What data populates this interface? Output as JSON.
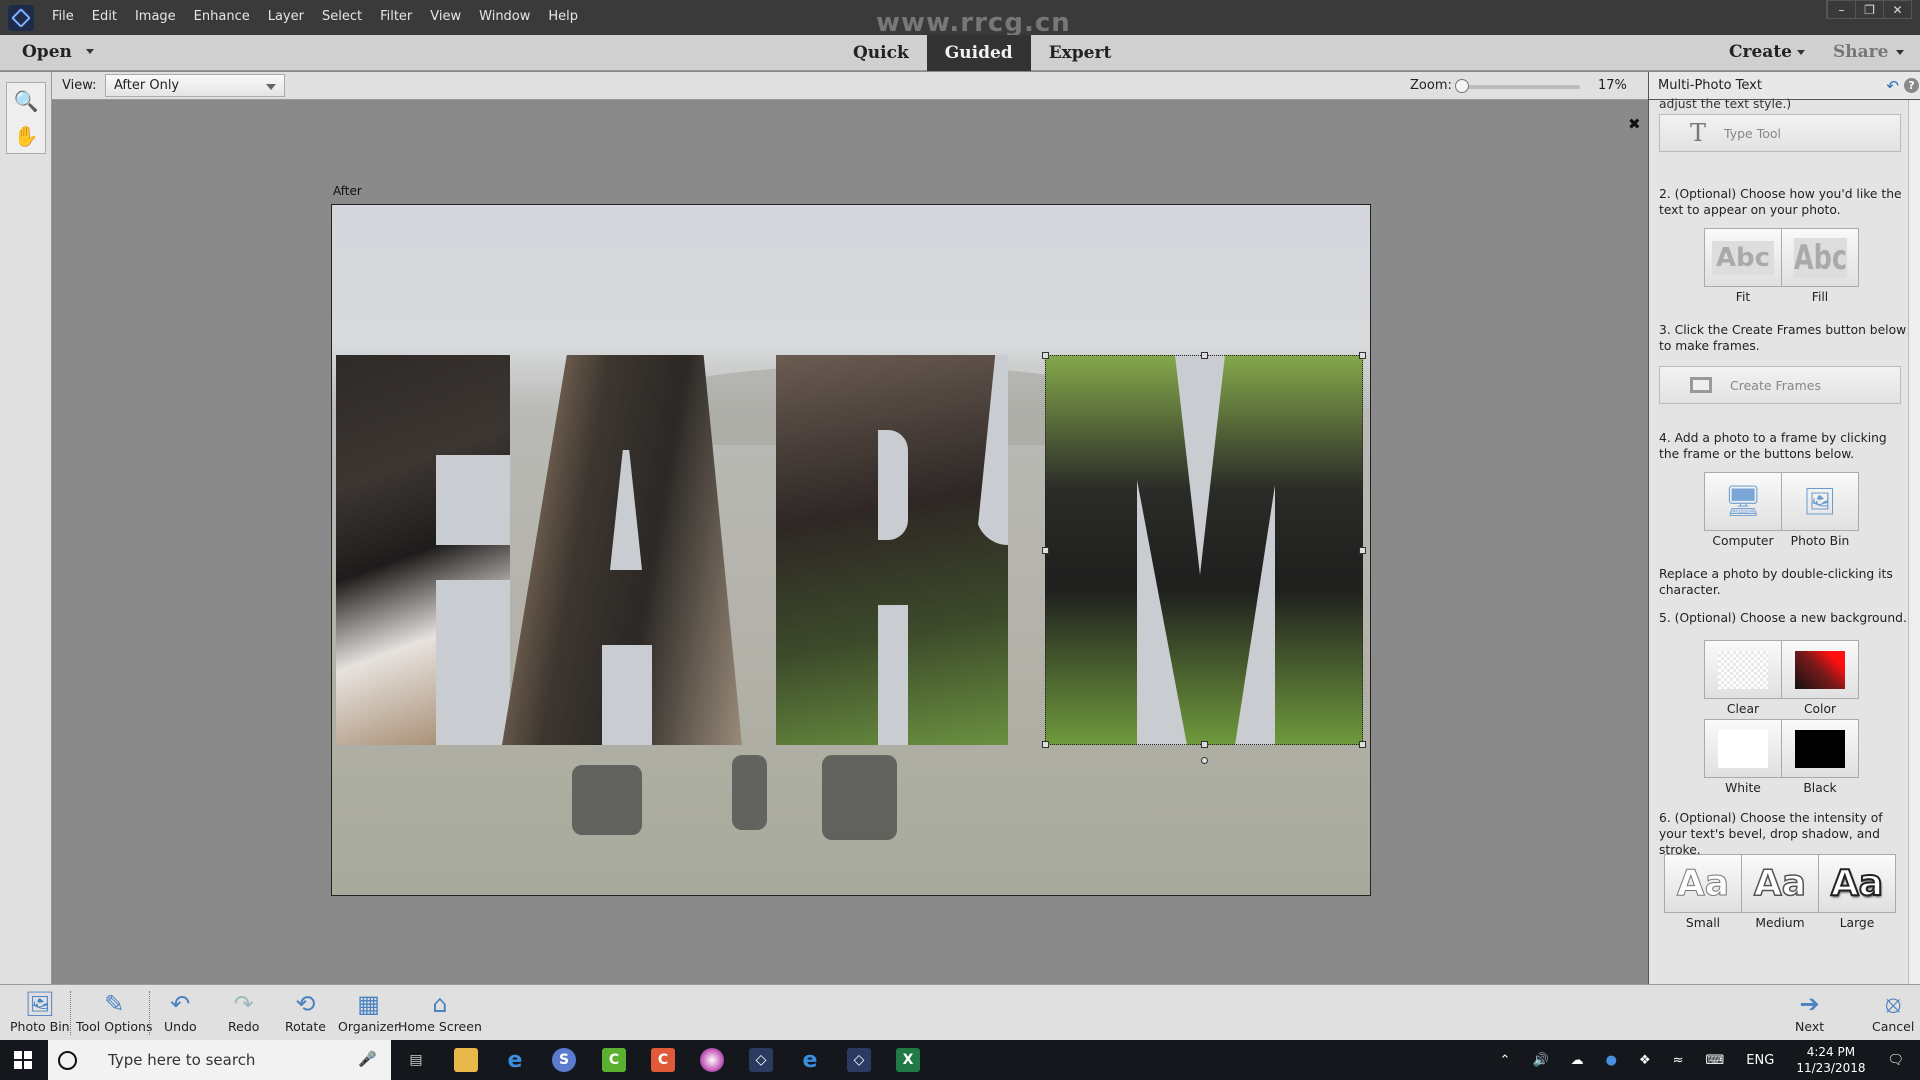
{
  "app": {
    "menu": [
      "File",
      "Edit",
      "Image",
      "Enhance",
      "Layer",
      "Select",
      "Filter",
      "View",
      "Window",
      "Help"
    ],
    "watermark": "www.rrcg.cn"
  },
  "topbar": {
    "open_label": "Open",
    "modes": [
      "Quick",
      "Guided",
      "Expert"
    ],
    "active_mode": "Guided",
    "create_label": "Create",
    "share_label": "Share"
  },
  "options": {
    "view_label": "View:",
    "view_value": "After Only",
    "zoom_label": "Zoom:",
    "zoom_value": "17%",
    "zoom_fraction": 0.17
  },
  "canvas": {
    "after_label": "After",
    "text_in_photo": "FARM"
  },
  "panel": {
    "title": "Multi-Photo Text",
    "step1_tail": "adjust the text style.)",
    "type_tool_label": "Type Tool",
    "step2": "2. (Optional) Choose how you'd like the text to appear on your photo.",
    "fit_label": "Fit",
    "fill_label": "Fill",
    "step3": "3. Click the Create Frames button below to make frames.",
    "create_frames_label": "Create Frames",
    "step4": "4. Add a photo to a frame by clicking the frame or the buttons below.",
    "computer_label": "Computer",
    "photo_bin_label": "Photo Bin",
    "replace_hint": "Replace a photo by double-clicking its character.",
    "step5": "5. (Optional) Choose a new background.",
    "bg_clear": "Clear",
    "bg_color": "Color",
    "bg_white": "White",
    "bg_black": "Black",
    "step6": "6. (Optional) Choose the intensity of your text's bevel, drop shadow, and stroke.",
    "fx_small": "Small",
    "fx_medium": "Medium",
    "fx_large": "Large",
    "fx_glyph": "Aa",
    "abc_glyph": "Abc"
  },
  "bottombar": {
    "photo_bin": "Photo Bin",
    "tool_options": "Tool Options",
    "undo": "Undo",
    "redo": "Redo",
    "rotate": "Rotate",
    "organizer": "Organizer",
    "home_screen": "Home Screen",
    "next": "Next",
    "cancel": "Cancel"
  },
  "taskbar": {
    "search_placeholder": "Type here to search",
    "lang": "ENG",
    "time": "4:24 PM",
    "date": "11/23/2018"
  }
}
